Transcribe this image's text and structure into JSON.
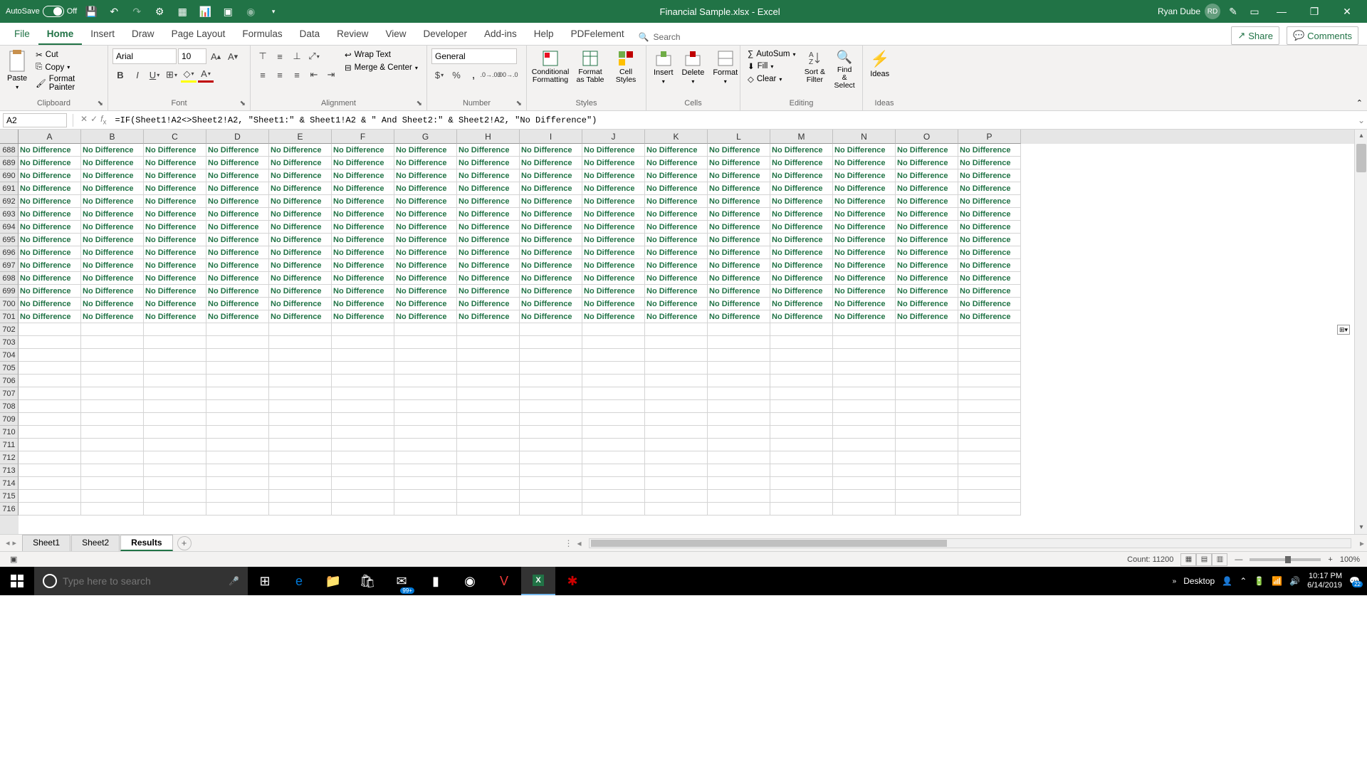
{
  "titlebar": {
    "autosave_label": "AutoSave",
    "autosave_state": "Off",
    "title": "Financial Sample.xlsx - Excel",
    "username": "Ryan Dube",
    "user_initials": "RD"
  },
  "tabs": {
    "items": [
      "File",
      "Home",
      "Insert",
      "Draw",
      "Page Layout",
      "Formulas",
      "Data",
      "Review",
      "View",
      "Developer",
      "Add-ins",
      "Help",
      "PDFelement"
    ],
    "active": "Home",
    "search_placeholder": "Search",
    "share_label": "Share",
    "comments_label": "Comments"
  },
  "ribbon": {
    "clipboard": {
      "label": "Clipboard",
      "paste": "Paste",
      "cut": "Cut",
      "copy": "Copy",
      "format_painter": "Format Painter"
    },
    "font": {
      "label": "Font",
      "name": "Arial",
      "size": "10"
    },
    "alignment": {
      "label": "Alignment",
      "wrap": "Wrap Text",
      "merge": "Merge & Center"
    },
    "number": {
      "label": "Number",
      "format": "General"
    },
    "styles": {
      "label": "Styles",
      "conditional": "Conditional Formatting",
      "format_as_table": "Format as Table",
      "cell_styles": "Cell Styles"
    },
    "cells": {
      "label": "Cells",
      "insert": "Insert",
      "delete": "Delete",
      "format": "Format"
    },
    "editing": {
      "label": "Editing",
      "autosum": "AutoSum",
      "fill": "Fill",
      "clear": "Clear",
      "sort": "Sort & Filter",
      "find": "Find & Select"
    },
    "ideas": {
      "label": "Ideas",
      "ideas": "Ideas"
    }
  },
  "formula_bar": {
    "name_box": "A2",
    "formula": "=IF(Sheet1!A2<>Sheet2!A2, \"Sheet1:\" & Sheet1!A2 & \" And Sheet2:\" & Sheet2!A2, \"No Difference\")"
  },
  "grid": {
    "columns": [
      "A",
      "B",
      "C",
      "D",
      "E",
      "F",
      "G",
      "H",
      "I",
      "J",
      "K",
      "L",
      "M",
      "N",
      "O",
      "P"
    ],
    "first_row": 688,
    "data_last_row": 701,
    "last_visible_row": 716,
    "cell_value": "No Difference"
  },
  "sheets": {
    "tabs": [
      "Sheet1",
      "Sheet2",
      "Results"
    ],
    "active": "Results"
  },
  "statusbar": {
    "count_label": "Count: 11200",
    "zoom": "100%"
  },
  "taskbar": {
    "search_placeholder": "Type here to search",
    "desktop_label": "Desktop",
    "badge": "99+",
    "notif_count": "22",
    "time": "10:17 PM",
    "date": "6/14/2019"
  }
}
